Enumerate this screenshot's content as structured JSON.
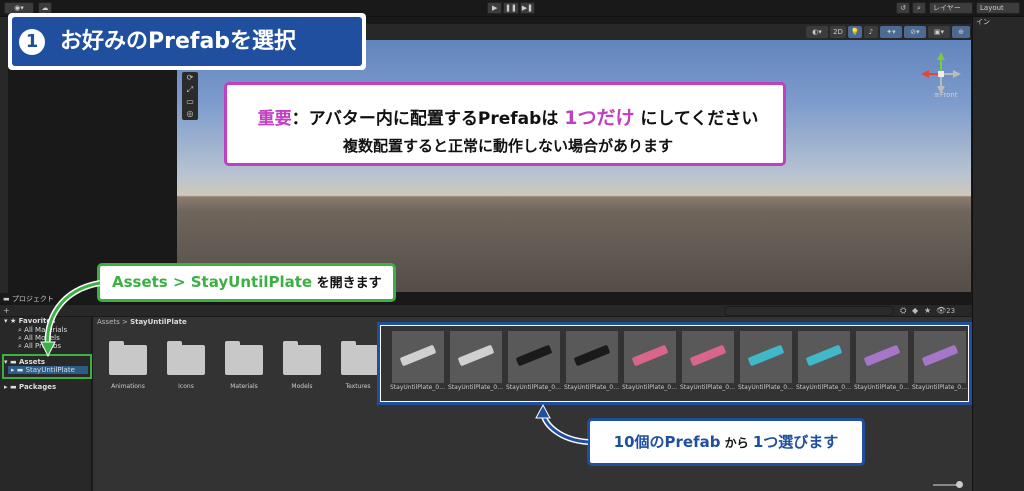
{
  "topbar": {
    "play": "▶",
    "pause": "❚❚",
    "step": "▶❚",
    "layers_label": "レイヤー",
    "layout_label": "Layout",
    "dropdown_arrow": "▾"
  },
  "scene": {
    "toolbar_2d": "2D",
    "gizmo_label": "≡Front",
    "tools": [
      "⟳",
      "⤢",
      "▭",
      "◎"
    ]
  },
  "inspector": {
    "tab_label": "イン"
  },
  "project": {
    "tab_label": "プロジェクト",
    "add_button": "+",
    "counter": "23",
    "tree": {
      "favorites": "Favorites",
      "fav_items": [
        "All Materials",
        "All Models",
        "All Prefabs"
      ],
      "assets": "Assets",
      "selected_folder": "StayUntilPlate",
      "packages": "Packages"
    },
    "breadcrumb_root": "Assets",
    "breadcrumb_sep": ">",
    "breadcrumb_current": "StayUntilPlate",
    "folders": [
      "Animations",
      "Icons",
      "Materials",
      "Models",
      "Textures"
    ],
    "prefab_label": "StayUntilPlate_0…",
    "prefab_colors": [
      "#d0d0d0",
      "#d0d0d0",
      "#1a1a1a",
      "#1a1a1a",
      "#d9668a",
      "#d9668a",
      "#3fb8c8",
      "#3fb8c8",
      "#a676c8",
      "#a676c8"
    ]
  },
  "annotations": {
    "step_number": "1",
    "step_title": "お好みのPrefabを選択",
    "note_important": "重要",
    "note_line1_a": "：アバター内に配置するPrefabは ",
    "note_line1_hl": "1つだけ",
    "note_line1_b": " にしてください",
    "note_line2": "複数配置すると正常に動作しない場合があります",
    "green_path": "Assets > StayUntilPlate",
    "green_suffix": " を開きます",
    "blue_prefix": "10個のPrefab",
    "blue_middle": " から ",
    "blue_hl": "1つ選びます"
  },
  "colors": {
    "title_blue": "#1f4f9e",
    "note_magenta": "#c13fc1",
    "green": "#3cb043"
  }
}
